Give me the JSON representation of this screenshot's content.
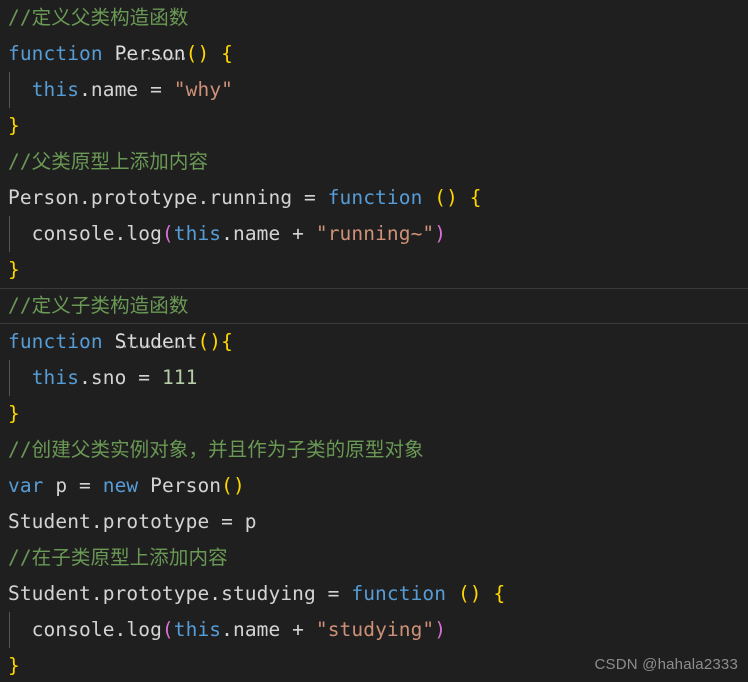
{
  "editor": {
    "theme_colors": {
      "background": "#1f1f1f",
      "foreground": "#d4d4d4",
      "comment": "#6a9955",
      "keyword": "#569cd6",
      "string": "#ce9178",
      "number": "#b5cea8",
      "bracket_yellow": "#ffd700",
      "bracket_magenta": "#da70d6",
      "indent_guide": "#565656",
      "current_line_border": "#3a3a3a"
    },
    "language": "javascript",
    "current_line_index": 8,
    "lines": [
      {
        "n": 1,
        "indent": 0,
        "current": false,
        "tokens": [
          {
            "t": "cmt",
            "v": "//定义父类构造函数"
          }
        ]
      },
      {
        "n": 2,
        "indent": 0,
        "current": false,
        "tokens": [
          {
            "t": "kw",
            "v": "function"
          },
          {
            "t": "plain",
            "v": " "
          },
          {
            "t": "fn dotted",
            "v": "Person"
          },
          {
            "t": "br-y",
            "v": "()"
          },
          {
            "t": "plain",
            "v": " "
          },
          {
            "t": "br-y",
            "v": "{"
          }
        ]
      },
      {
        "n": 3,
        "indent": 1,
        "current": false,
        "tokens": [
          {
            "t": "plain",
            "v": "  "
          },
          {
            "t": "kw",
            "v": "this"
          },
          {
            "t": "plain",
            "v": ".name = "
          },
          {
            "t": "str",
            "v": "\"why\""
          }
        ]
      },
      {
        "n": 4,
        "indent": 0,
        "current": false,
        "tokens": [
          {
            "t": "br-y",
            "v": "}"
          }
        ]
      },
      {
        "n": 5,
        "indent": 0,
        "current": false,
        "tokens": [
          {
            "t": "cmt",
            "v": "//父类原型上添加内容"
          }
        ]
      },
      {
        "n": 6,
        "indent": 0,
        "current": false,
        "tokens": [
          {
            "t": "plain",
            "v": "Person.prototype.running = "
          },
          {
            "t": "kw",
            "v": "function"
          },
          {
            "t": "plain",
            "v": " "
          },
          {
            "t": "br-y",
            "v": "()"
          },
          {
            "t": "plain",
            "v": " "
          },
          {
            "t": "br-y",
            "v": "{"
          }
        ]
      },
      {
        "n": 7,
        "indent": 1,
        "current": false,
        "tokens": [
          {
            "t": "plain",
            "v": "  console.log"
          },
          {
            "t": "br-m",
            "v": "("
          },
          {
            "t": "kw",
            "v": "this"
          },
          {
            "t": "plain",
            "v": ".name + "
          },
          {
            "t": "str",
            "v": "\"running~\""
          },
          {
            "t": "br-m",
            "v": ")"
          }
        ]
      },
      {
        "n": 8,
        "indent": 0,
        "current": false,
        "tokens": [
          {
            "t": "br-y",
            "v": "}"
          }
        ]
      },
      {
        "n": 9,
        "indent": 0,
        "current": true,
        "tokens": [
          {
            "t": "cmt",
            "v": "//定义子类构造函数"
          }
        ]
      },
      {
        "n": 10,
        "indent": 0,
        "current": false,
        "tokens": [
          {
            "t": "kw",
            "v": "function"
          },
          {
            "t": "plain",
            "v": " "
          },
          {
            "t": "fn dotted",
            "v": "Student"
          },
          {
            "t": "br-y",
            "v": "()"
          },
          {
            "t": "br-y",
            "v": "{"
          }
        ]
      },
      {
        "n": 11,
        "indent": 1,
        "current": false,
        "tokens": [
          {
            "t": "plain",
            "v": "  "
          },
          {
            "t": "kw",
            "v": "this"
          },
          {
            "t": "plain",
            "v": ".sno = "
          },
          {
            "t": "num",
            "v": "111"
          }
        ]
      },
      {
        "n": 12,
        "indent": 0,
        "current": false,
        "tokens": [
          {
            "t": "br-y",
            "v": "}"
          }
        ]
      },
      {
        "n": 13,
        "indent": 0,
        "current": false,
        "tokens": [
          {
            "t": "cmt",
            "v": "//创建父类实例对象，并且作为子类的原型对象"
          }
        ]
      },
      {
        "n": 14,
        "indent": 0,
        "current": false,
        "tokens": [
          {
            "t": "kw",
            "v": "var"
          },
          {
            "t": "plain",
            "v": " p = "
          },
          {
            "t": "kw",
            "v": "new"
          },
          {
            "t": "plain",
            "v": " Person"
          },
          {
            "t": "br-y",
            "v": "()"
          }
        ]
      },
      {
        "n": 15,
        "indent": 0,
        "current": false,
        "tokens": [
          {
            "t": "plain",
            "v": "Student.prototype = p"
          }
        ]
      },
      {
        "n": 16,
        "indent": 0,
        "current": false,
        "tokens": [
          {
            "t": "cmt",
            "v": "//在子类原型上添加内容"
          }
        ]
      },
      {
        "n": 17,
        "indent": 0,
        "current": false,
        "tokens": [
          {
            "t": "plain",
            "v": "Student.prototype.studying = "
          },
          {
            "t": "kw",
            "v": "function"
          },
          {
            "t": "plain",
            "v": " "
          },
          {
            "t": "br-y",
            "v": "()"
          },
          {
            "t": "plain",
            "v": " "
          },
          {
            "t": "br-y",
            "v": "{"
          }
        ]
      },
      {
        "n": 18,
        "indent": 1,
        "current": false,
        "tokens": [
          {
            "t": "plain",
            "v": "  console.log"
          },
          {
            "t": "br-m",
            "v": "("
          },
          {
            "t": "kw",
            "v": "this"
          },
          {
            "t": "plain",
            "v": ".name + "
          },
          {
            "t": "str",
            "v": "\"studying\""
          },
          {
            "t": "br-m",
            "v": ")"
          }
        ]
      },
      {
        "n": 19,
        "indent": 0,
        "current": false,
        "tokens": [
          {
            "t": "br-y",
            "v": "}"
          }
        ]
      }
    ]
  },
  "watermark": {
    "text": "CSDN @hahala2333"
  }
}
